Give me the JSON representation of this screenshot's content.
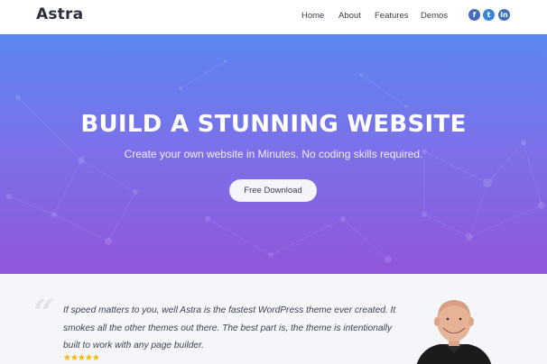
{
  "header": {
    "logo": "Astra",
    "nav": [
      "Home",
      "About",
      "Features",
      "Demos"
    ],
    "social": [
      {
        "icon": "facebook-icon",
        "glyph": "f"
      },
      {
        "icon": "twitter-icon",
        "glyph": "t"
      },
      {
        "icon": "linkedin-icon",
        "glyph": "in"
      }
    ]
  },
  "hero": {
    "title": "BUILD A STUNNING WEBSITE",
    "subtitle": "Create your own website in Minutes. No coding skills required.",
    "button": "Free Download"
  },
  "testimonial": {
    "quote_mark": "“",
    "text": "If speed matters to you, well Astra is the fastest WordPress theme ever created. It smokes all the other themes out there. The best part is, the theme is intentionally built to work with any page builder.",
    "stars": "★★★★★"
  },
  "colors": {
    "hero_top": "#5a86f0",
    "hero_bottom": "#9157dc",
    "star": "#f5b50a"
  }
}
